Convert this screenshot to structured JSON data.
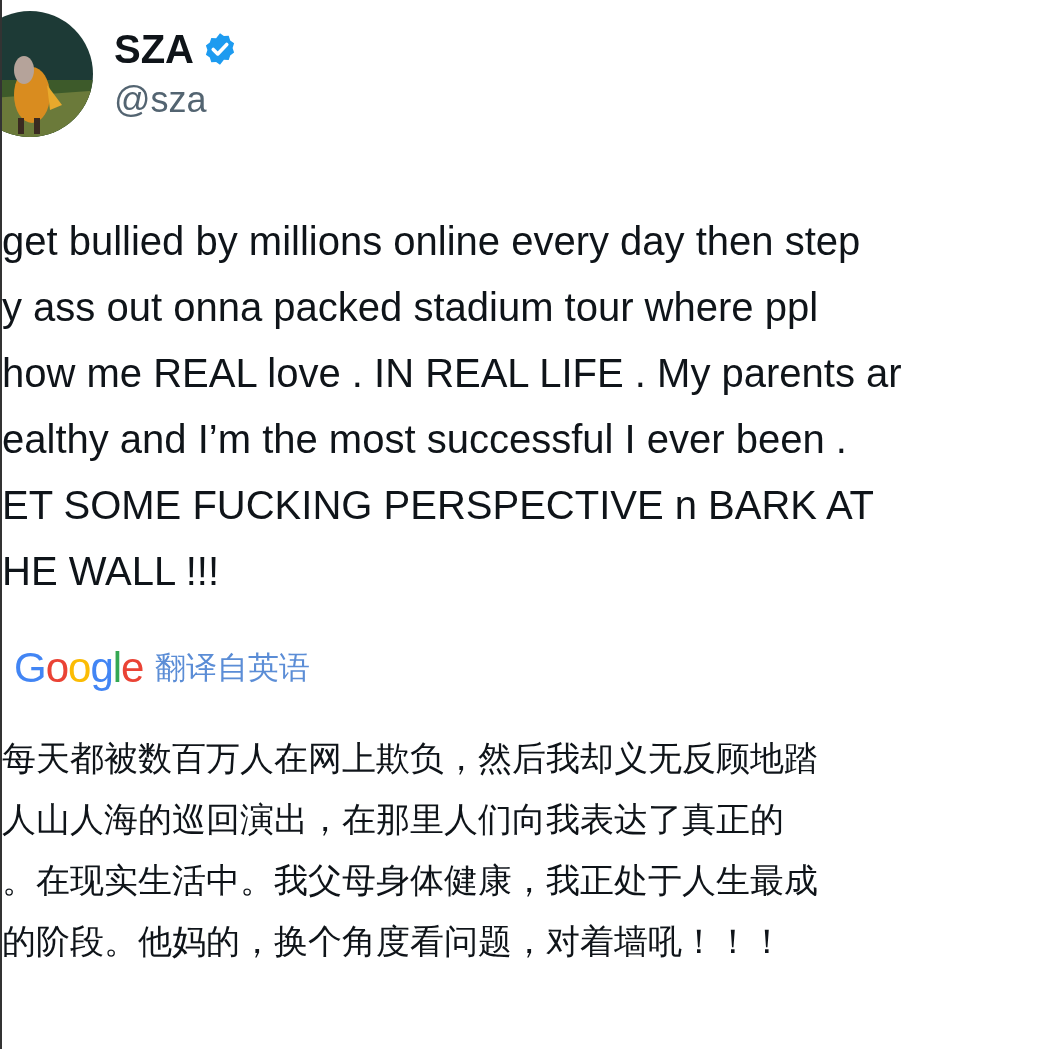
{
  "author": {
    "name": "SZA",
    "verified": true,
    "handle": "@sza"
  },
  "tweet_lines": [
    "get bullied by millions online every day then step",
    "y ass out onna packed stadium tour where ppl",
    "how me REAL love . IN REAL LIFE . My parents ar",
    "ealthy and I’m the most successful I ever been .",
    "ET SOME FUCKING PERSPECTIVE n BARK AT",
    "HE WALL !!!"
  ],
  "translation": {
    "provider": "Google",
    "label": "翻译自英语",
    "lines": [
      "每天都被数百万人在网上欺负，然后我却义无反顾地踏",
      "人山人海的巡回演出，在那里人们向我表达了真正的",
      "。在现实生活中。我父母身体健康，我正处于人生最成",
      "的阶段。他妈的，换个角度看问题，对着墙吼！！！"
    ]
  }
}
